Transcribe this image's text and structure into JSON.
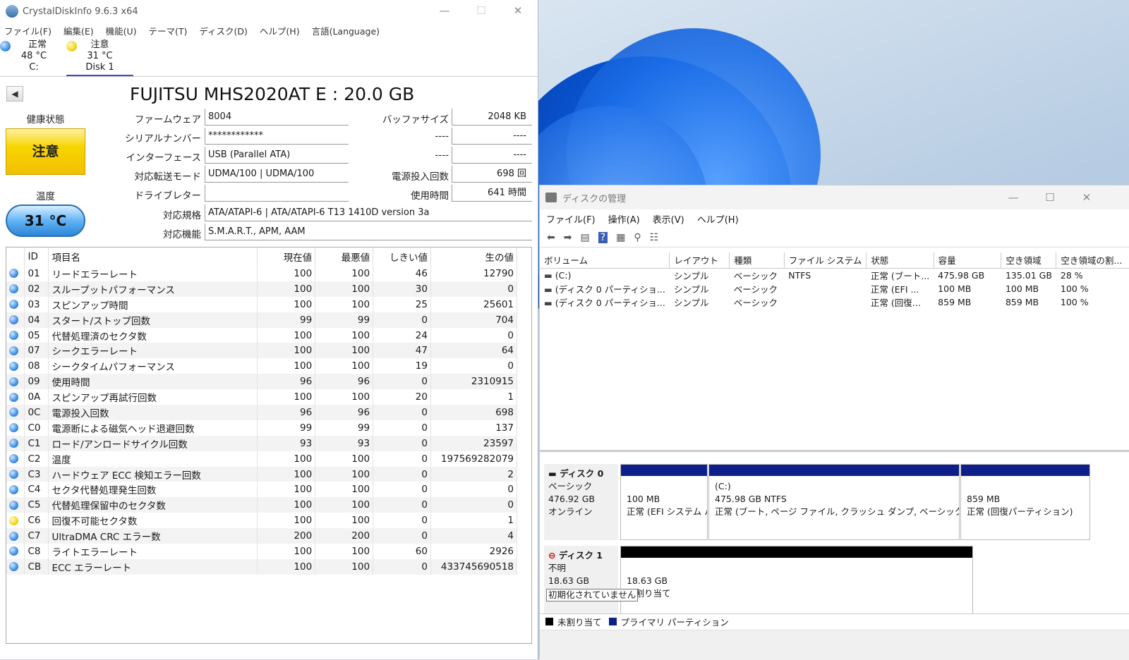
{
  "cdi": {
    "title": "CrystalDiskInfo 9.6.3 x64",
    "menu": [
      "ファイル(F)",
      "編集(E)",
      "機能(U)",
      "テーマ(T)",
      "ディスク(D)",
      "ヘルプ(H)",
      "言語(Language)"
    ],
    "disks": [
      {
        "status": "正常",
        "temp": "48 °C",
        "name": "C:",
        "color": "#3f8ee6"
      },
      {
        "status": "注意",
        "temp": "31 °C",
        "name": "Disk 1",
        "color": "#f4d51b"
      }
    ],
    "drive_title": "FUJITSU MHS2020AT  E : 20.0 GB",
    "health_label": "健康状態",
    "health_value": "注意",
    "temp_label": "温度",
    "temp_value": "31 °C",
    "fields": {
      "firmware_label": "ファームウェア",
      "firmware": "8004",
      "serial_label": "シリアルナンバー",
      "serial": "************",
      "interface_label": "インターフェース",
      "interface": "USB (Parallel ATA)",
      "transfer_label": "対応転送モード",
      "transfer": "UDMA/100 | UDMA/100",
      "letter_label": "ドライブレター",
      "letter": "",
      "standard_label": "対応規格",
      "standard": "ATA/ATAPI-6 | ATA/ATAPI-6 T13 1410D version 3a",
      "features_label": "対応機能",
      "features": "S.M.A.R.T., APM, AAM",
      "buffer_label": "バッファサイズ",
      "buffer": "2048 KB",
      "blank1_label": "----",
      "blank1": "----",
      "blank2_label": "----",
      "blank2": "----",
      "power_count_label": "電源投入回数",
      "power_count": "698 回",
      "power_hours_label": "使用時間",
      "power_hours": "641 時間"
    },
    "smart_headers": [
      "ID",
      "項目名",
      "現在値",
      "最悪値",
      "しきい値",
      "生の値"
    ],
    "smart_rows": [
      {
        "s": "ok",
        "id": "01",
        "name": "リードエラーレート",
        "cur": "100",
        "worst": "100",
        "th": "46",
        "raw": "12790"
      },
      {
        "s": "ok",
        "id": "02",
        "name": "スループットパフォーマンス",
        "cur": "100",
        "worst": "100",
        "th": "30",
        "raw": "0"
      },
      {
        "s": "ok",
        "id": "03",
        "name": "スピンアップ時間",
        "cur": "100",
        "worst": "100",
        "th": "25",
        "raw": "25601"
      },
      {
        "s": "ok",
        "id": "04",
        "name": "スタート/ストップ回数",
        "cur": "99",
        "worst": "99",
        "th": "0",
        "raw": "704"
      },
      {
        "s": "ok",
        "id": "05",
        "name": "代替処理済のセクタ数",
        "cur": "100",
        "worst": "100",
        "th": "24",
        "raw": "0"
      },
      {
        "s": "ok",
        "id": "07",
        "name": "シークエラーレート",
        "cur": "100",
        "worst": "100",
        "th": "47",
        "raw": "64"
      },
      {
        "s": "ok",
        "id": "08",
        "name": "シークタイムパフォーマンス",
        "cur": "100",
        "worst": "100",
        "th": "19",
        "raw": "0"
      },
      {
        "s": "ok",
        "id": "09",
        "name": "使用時間",
        "cur": "96",
        "worst": "96",
        "th": "0",
        "raw": "2310915"
      },
      {
        "s": "ok",
        "id": "0A",
        "name": "スピンアップ再試行回数",
        "cur": "100",
        "worst": "100",
        "th": "20",
        "raw": "1"
      },
      {
        "s": "ok",
        "id": "0C",
        "name": "電源投入回数",
        "cur": "96",
        "worst": "96",
        "th": "0",
        "raw": "698"
      },
      {
        "s": "ok",
        "id": "C0",
        "name": "電源断による磁気ヘッド退避回数",
        "cur": "99",
        "worst": "99",
        "th": "0",
        "raw": "137"
      },
      {
        "s": "ok",
        "id": "C1",
        "name": "ロード/アンロードサイクル回数",
        "cur": "93",
        "worst": "93",
        "th": "0",
        "raw": "23597"
      },
      {
        "s": "ok",
        "id": "C2",
        "name": "温度",
        "cur": "100",
        "worst": "100",
        "th": "0",
        "raw": "197569282079"
      },
      {
        "s": "ok",
        "id": "C3",
        "name": "ハードウェア ECC 検知エラー回数",
        "cur": "100",
        "worst": "100",
        "th": "0",
        "raw": "2"
      },
      {
        "s": "ok",
        "id": "C4",
        "name": "セクタ代替処理発生回数",
        "cur": "100",
        "worst": "100",
        "th": "0",
        "raw": "0"
      },
      {
        "s": "ok",
        "id": "C5",
        "name": "代替処理保留中のセクタ数",
        "cur": "100",
        "worst": "100",
        "th": "0",
        "raw": "0"
      },
      {
        "s": "warn",
        "id": "C6",
        "name": "回復不可能セクタ数",
        "cur": "100",
        "worst": "100",
        "th": "0",
        "raw": "1"
      },
      {
        "s": "ok",
        "id": "C7",
        "name": "UltraDMA CRC エラー数",
        "cur": "200",
        "worst": "200",
        "th": "0",
        "raw": "4"
      },
      {
        "s": "ok",
        "id": "C8",
        "name": "ライトエラーレート",
        "cur": "100",
        "worst": "100",
        "th": "60",
        "raw": "2926"
      },
      {
        "s": "ok",
        "id": "CB",
        "name": "ECC エラーレート",
        "cur": "100",
        "worst": "100",
        "th": "0",
        "raw": "433745690518"
      }
    ]
  },
  "dm": {
    "title": "ディスクの管理",
    "menu": [
      "ファイル(F)",
      "操作(A)",
      "表示(V)",
      "ヘルプ(H)"
    ],
    "vol_headers": [
      "ボリューム",
      "レイアウト",
      "種類",
      "ファイル システム",
      "状態",
      "容量",
      "空き領域",
      "空き領域の割..."
    ],
    "volumes": [
      [
        "(C:)",
        "シンプル",
        "ベーシック",
        "NTFS",
        "正常 (ブート...",
        "475.98 GB",
        "135.01 GB",
        "28 %"
      ],
      [
        "(ディスク 0 パーティショ...",
        "シンプル",
        "ベーシック",
        "",
        "正常 (EFI ...",
        "100 MB",
        "100 MB",
        "100 %"
      ],
      [
        "(ディスク 0 パーティショ...",
        "シンプル",
        "ベーシック",
        "",
        "正常 (回復...",
        "859 MB",
        "859 MB",
        "100 %"
      ]
    ],
    "disk0": {
      "name": "ディスク 0",
      "type": "ベーシック",
      "size": "476.92 GB",
      "status": "オンライン",
      "parts": [
        {
          "line1": "",
          "line2": "100 MB",
          "line3": "正常 (EFI システム パーティション)"
        },
        {
          "line1": "(C:)",
          "line2": "475.98 GB NTFS",
          "line3": "正常 (ブート, ページ ファイル, クラッシュ ダンプ, ベーシック データ パーティション)"
        },
        {
          "line1": "",
          "line2": "859 MB",
          "line3": "正常 (回復パーティション)"
        }
      ]
    },
    "disk1": {
      "name": "ディスク 1",
      "type": "不明",
      "size": "18.63 GB",
      "status": "初期化されていません",
      "part_size": "18.63 GB",
      "part_label": "未割り当て"
    },
    "legend": [
      "未割り当て",
      "プライマリ パーティション"
    ]
  }
}
